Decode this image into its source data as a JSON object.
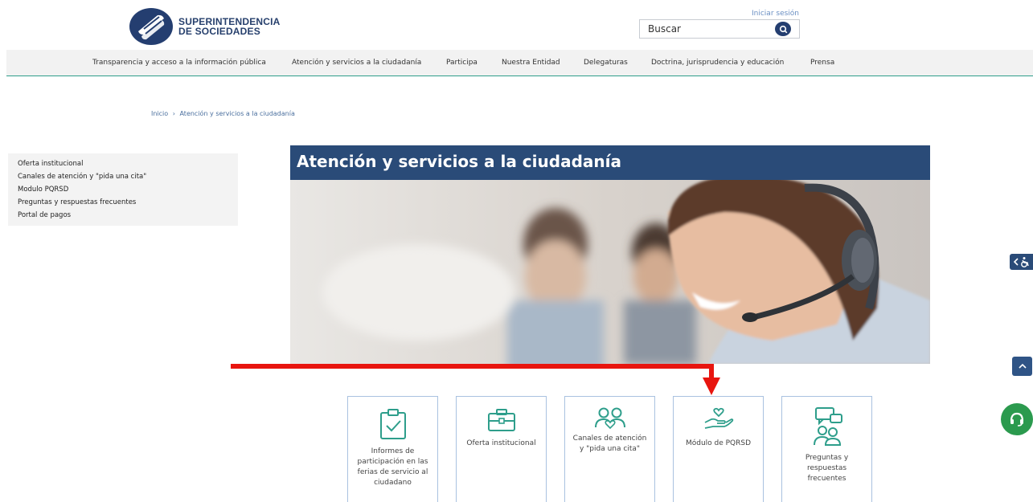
{
  "header": {
    "logo_line1": "SUPERINTENDENCIA",
    "logo_line2": "DE SOCIEDADES",
    "login_link": "Iniciar sesión",
    "search_placeholder": "Buscar"
  },
  "nav": {
    "items": [
      "Transparencia y acceso a la información pública",
      "Atención y servicios a la ciudadanía",
      "Participa",
      "Nuestra Entidad",
      "Delegaturas",
      "Doctrina, jurisprudencia y educación",
      "Prensa"
    ]
  },
  "breadcrumb": {
    "home": "Inicio",
    "separator": "›",
    "current": "Atención y servicios a la ciudadanía"
  },
  "sidebar": {
    "items": [
      "Oferta institucional",
      "Canales de atención y \"pida una cita\"",
      "Modulo PQRSD",
      "Preguntas y respuestas frecuentes",
      "Portal de pagos"
    ]
  },
  "banner": {
    "title": "Atención y servicios a la ciudadanía"
  },
  "cards": [
    {
      "label": "Informes de participación en las ferias de servicio al ciudadano",
      "icon": "clipboard-check-icon"
    },
    {
      "label": "Oferta institucional",
      "icon": "briefcase-icon"
    },
    {
      "label": "Canales de atención y \"pida una cita\"",
      "icon": "people-heart-icon"
    },
    {
      "label": "Módulo de PQRSD",
      "icon": "hand-heart-icon"
    },
    {
      "label": "Preguntas y respuestas frecuentes",
      "icon": "people-chat-icon"
    }
  ],
  "colors": {
    "brand_navy": "#2a4b78",
    "accent_teal": "#2f9e8a",
    "annotation_red": "#e8150f",
    "help_green": "#2b9a4e"
  }
}
